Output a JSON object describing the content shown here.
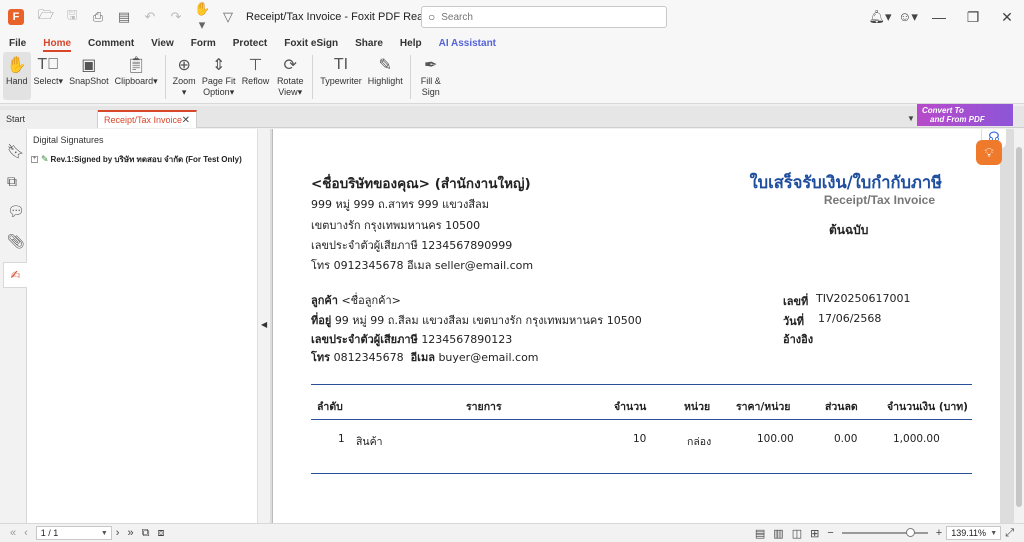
{
  "window": {
    "title": "Receipt/Tax Invoice - Foxit PDF Reader",
    "app_logo": "Foxit logo",
    "search_placeholder": "Search"
  },
  "menu": {
    "tabs": [
      "File",
      "Home",
      "Comment",
      "View",
      "Form",
      "Protect",
      "Foxit eSign",
      "Share",
      "Help",
      "AI Assistant"
    ],
    "active": "Home"
  },
  "ribbon": {
    "tools": [
      {
        "label": "Hand",
        "icon": "hand-icon"
      },
      {
        "label": "Select",
        "icon": "select-text-icon",
        "dropdown": true
      },
      {
        "label": "SnapShot",
        "icon": "snapshot-icon"
      },
      {
        "label": "Clipboard",
        "icon": "clipboard-icon",
        "dropdown": true
      },
      {
        "label": "Zoom",
        "icon": "zoom-icon",
        "dropdown": true
      },
      {
        "label": "Page Fit Option",
        "icon": "page-fit-icon",
        "dropdown": true
      },
      {
        "label": "Reflow",
        "icon": "reflow-icon"
      },
      {
        "label": "Rotate View",
        "icon": "rotate-view-icon",
        "dropdown": true
      },
      {
        "label": "Typewriter",
        "icon": "typewriter-icon"
      },
      {
        "label": "Highlight",
        "icon": "highlight-icon"
      },
      {
        "label": "Fill & Sign",
        "icon": "fill-sign-icon"
      }
    ]
  },
  "tabs": {
    "start": "Start",
    "current": "Receipt/Tax Invoice",
    "banner_line1": "Convert To",
    "banner_line2": "and From PDF"
  },
  "panel": {
    "title": "Digital Signatures",
    "signature": "Rev.1:Signed by บริษัท ทดสอบ จำกัด (For Test Only)"
  },
  "document": {
    "company_name": "<ชื่อบริษัทของคุณ> (สำนักงานใหญ่)",
    "address_line1": "999 หมู่ 999 ถ.สาทร 999 แขวงสีลม",
    "address_line2": "เขตบางรัก  กรุงเทพมหานคร 10500",
    "tax_id_line": "เลขประจำตัวผู้เสียภาษี 1234567890999",
    "contact_line": "โทร 0912345678  อีเมล seller@email.com",
    "title_th": "ใบเสร็จรับเงิน/ใบกำกับภาษี",
    "title_en": "Receipt/Tax Invoice",
    "original": "ต้นฉบับ",
    "customer": {
      "label": "ลูกค้า",
      "name": "<ชื่อลูกค้า>",
      "address_label": "ที่อยู่",
      "address": "99 หมู่ 99 ถ.สีลม แขวงสีลม เขตบางรัก กรุงเทพมหานคร 10500",
      "taxid_label": "เลขประจำตัวผู้เสียภาษี",
      "taxid": "1234567890123",
      "phone_label": "โทร",
      "phone": "0812345678",
      "email_label": "อีเมล",
      "email": "buyer@email.com"
    },
    "meta": {
      "no_label": "เลขที่",
      "no": "TIV20250617001",
      "date_label": "วันที่",
      "date": "17/06/2568",
      "ref_label": "อ้างอิง"
    },
    "table": {
      "headers": [
        "ลำดับ",
        "รายการ",
        "จำนวน",
        "หน่วย",
        "ราคา/หน่วย",
        "ส่วนลด",
        "จำนวนเงิน (บาท)"
      ],
      "rows": [
        [
          "1",
          "สินค้า",
          "10",
          "กล่อง",
          "100.00",
          "0.00",
          "1,000.00"
        ]
      ]
    }
  },
  "status": {
    "page": "1 / 1",
    "zoom": "139.11%"
  },
  "colors": {
    "accent": "#d9472b",
    "title_blue": "#1f4e9e",
    "ai": "#5563d8"
  }
}
